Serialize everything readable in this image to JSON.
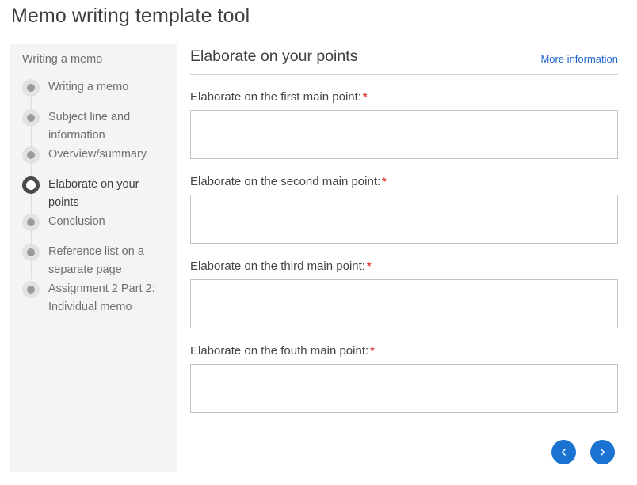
{
  "page": {
    "title": "Memo writing template tool"
  },
  "sidebar": {
    "heading": "Writing a memo",
    "items": [
      {
        "label": "Writing a memo",
        "active": false
      },
      {
        "label": "Subject line and information",
        "active": false
      },
      {
        "label": "Overview/summary",
        "active": false
      },
      {
        "label": "Elaborate on your points",
        "active": true
      },
      {
        "label": "Conclusion",
        "active": false
      },
      {
        "label": "Reference list on a separate page",
        "active": false
      },
      {
        "label": "Assignment 2 Part 2: Individual memo",
        "active": false
      }
    ]
  },
  "main": {
    "title": "Elaborate on your points",
    "more_info_label": "More information",
    "fields": [
      {
        "label": "Elaborate on the first main point:",
        "required": true,
        "value": "",
        "placeholder": ""
      },
      {
        "label": "Elaborate on the second main point:",
        "required": true,
        "value": "",
        "placeholder": ""
      },
      {
        "label": "Elaborate on the third main point:",
        "required": true,
        "value": "",
        "placeholder": ""
      },
      {
        "label": "Elaborate on the fouth main point:",
        "required": true,
        "value": "",
        "placeholder": ""
      }
    ],
    "required_marker": "*"
  },
  "pager": {
    "previous_label": "Previous",
    "next_label": "Next",
    "previous_icon": "chevron-left-icon",
    "next_icon": "chevron-right-icon"
  },
  "colors": {
    "accent_blue": "#1a73d1",
    "link_blue": "#2266cc",
    "required_red": "#e23c3c",
    "sidebar_bg": "#f4f4f4",
    "bullet_inactive": "#9b9b9b",
    "bullet_active_ring": "#4a4a4a"
  }
}
